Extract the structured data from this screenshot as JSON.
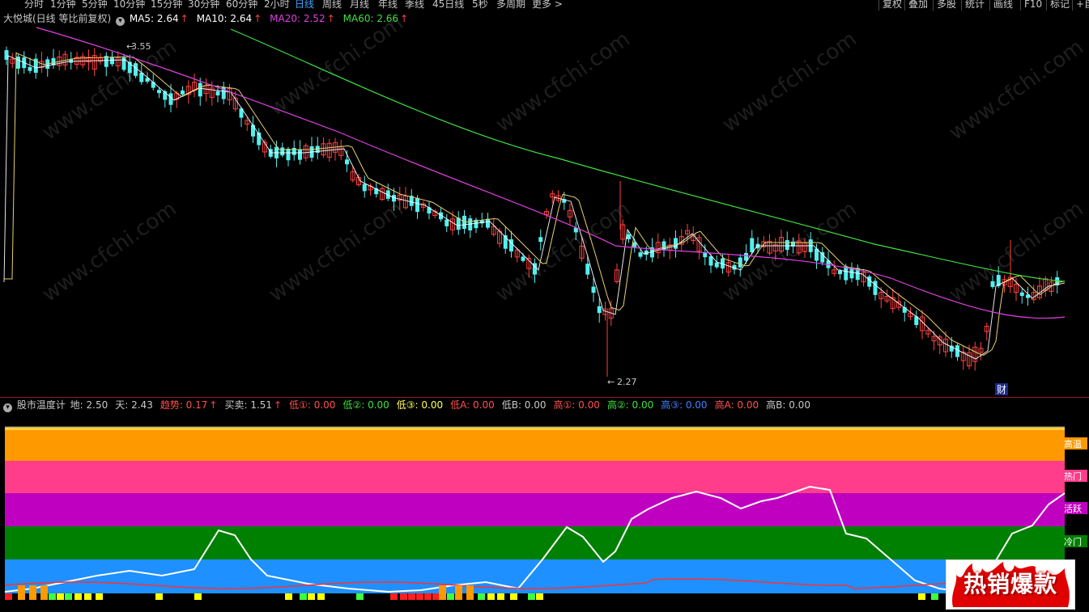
{
  "toolbar": {
    "periods": [
      "分时",
      "1分钟",
      "5分钟",
      "10分钟",
      "15分钟",
      "30分钟",
      "60分钟",
      "2小时",
      "日线",
      "周线",
      "月线",
      "年线",
      "季线",
      "45日线",
      "5秒",
      "多周期",
      "更多 >"
    ],
    "active_period": "日线",
    "right_buttons": [
      "复权",
      "叠加",
      "多股",
      "统计",
      "画线",
      "F10",
      "标记",
      "+自"
    ]
  },
  "main": {
    "stock_title": "大悦城(日线 等比前复权)",
    "ma": [
      {
        "label": "MA5: 2.64",
        "color": "#ffffff"
      },
      {
        "label": "MA10: 2.64",
        "color": "#ffffff"
      },
      {
        "label": "MA20: 2.52",
        "color": "#e040e0"
      },
      {
        "label": "MA60: 2.66",
        "color": "#40e040"
      }
    ],
    "up_arrow": "↑",
    "high_label": "3.55",
    "low_label": "2.27",
    "finance_badge": "财",
    "watermark": "www.cfchi.com"
  },
  "indicator": {
    "name": "股市温度计",
    "values": [
      {
        "label": "地: 2.50",
        "color": "#c8c8c8"
      },
      {
        "label": "天: 2.43",
        "color": "#c8c8c8"
      },
      {
        "label": "趋势: 0.17",
        "color": "#ff5050",
        "arrow": "↑"
      },
      {
        "label": "买卖: 1.51",
        "color": "#c8c8c8",
        "arrow": "↑"
      },
      {
        "label": "低①: 0.00",
        "color": "#ff5050"
      },
      {
        "label": "低②: 0.00",
        "color": "#40e040"
      },
      {
        "label": "低③: 0.00",
        "color": "#ffff60"
      },
      {
        "label": "低A: 0.00",
        "color": "#ff5050"
      },
      {
        "label": "低B: 0.00",
        "color": "#c8c8c8"
      },
      {
        "label": "高①: 0.00",
        "color": "#ff5050"
      },
      {
        "label": "高②: 0.00",
        "color": "#40e040"
      },
      {
        "label": "高③: 0.00",
        "color": "#4080ff"
      },
      {
        "label": "高A: 0.00",
        "color": "#ff5050"
      },
      {
        "label": "高B: 0.00",
        "color": "#c8c8c8"
      }
    ],
    "zones": [
      {
        "label": "高温",
        "color": "#ff9900"
      },
      {
        "label": "热门",
        "color": "#ff3d8a"
      },
      {
        "label": "活跃",
        "color": "#c000c0"
      },
      {
        "label": "冷门",
        "color": "#008000"
      },
      {
        "label": "",
        "color": "#1e90ff"
      }
    ]
  },
  "promo": {
    "text": "热销爆款"
  },
  "colors": {
    "up": "#ff4040",
    "down": "#54f0f0",
    "bg": "#000000",
    "grid": "#8b1e1e"
  }
}
